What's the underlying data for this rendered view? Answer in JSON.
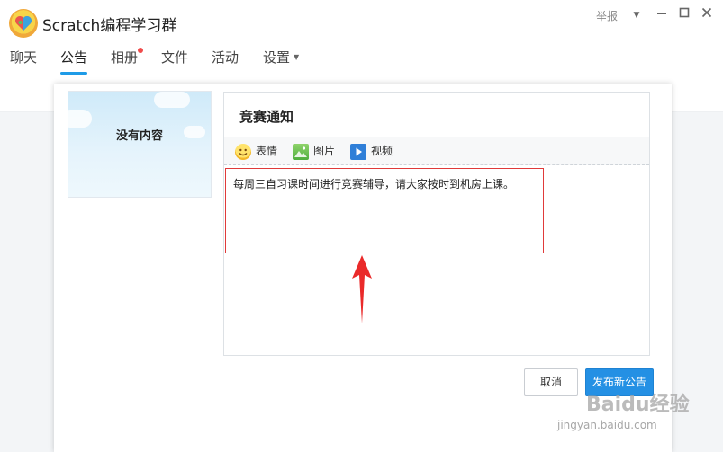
{
  "window": {
    "title": "Scratch编程学习群",
    "report_label": "举报",
    "controls": [
      "chevron-down-icon",
      "minimize-icon",
      "maximize-icon",
      "close-icon"
    ]
  },
  "tabs": [
    {
      "label": "聊天",
      "active": false
    },
    {
      "label": "公告",
      "active": true
    },
    {
      "label": "相册",
      "active": false,
      "badge": "red-dot"
    },
    {
      "label": "文件",
      "active": false
    },
    {
      "label": "活动",
      "active": false
    },
    {
      "label": "设置",
      "active": false,
      "dropdown": true
    }
  ],
  "accent_color": "#1e9be7",
  "empty_card": {
    "text": "没有内容"
  },
  "editor": {
    "title": "竞赛通知",
    "toolbar": [
      {
        "label": "表情",
        "icon": "emoji-icon"
      },
      {
        "label": "图片",
        "icon": "image-icon"
      },
      {
        "label": "视频",
        "icon": "video-icon"
      }
    ],
    "body": "每周三自习课时间进行竞赛辅导，请大家按时到机房上课。"
  },
  "annotation": {
    "highlight_color": "#e03a3a"
  },
  "buttons": {
    "cancel": "取消",
    "publish": "发布新公告"
  },
  "watermark": {
    "main": "Baidu经验",
    "sub": "jingyan.baidu.com"
  }
}
